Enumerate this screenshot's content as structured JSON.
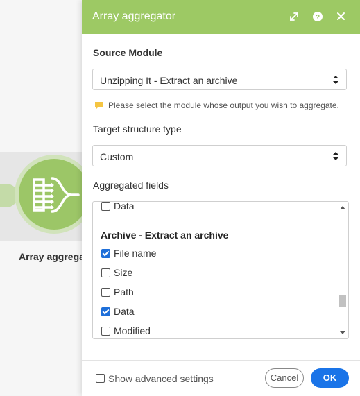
{
  "canvas": {
    "module_name": "Array aggregat"
  },
  "dialog": {
    "title": "Array aggregator",
    "header_color": "#9dc964",
    "source_module": {
      "label": "Source Module",
      "value": "Unzipping It - Extract an archive"
    },
    "hint": "Please select the module whose output you wish to aggregate.",
    "target_structure": {
      "label": "Target structure type",
      "value": "Custom"
    },
    "aggregated_fields": {
      "label": "Aggregated fields",
      "top_item": {
        "label": "Data",
        "checked": false
      },
      "group_title": "Archive - Extract an archive",
      "items": [
        {
          "label": "File name",
          "checked": true
        },
        {
          "label": "Size",
          "checked": false
        },
        {
          "label": "Path",
          "checked": false
        },
        {
          "label": "Data",
          "checked": true
        },
        {
          "label": "Modified",
          "checked": false
        }
      ]
    },
    "footer": {
      "advanced_label": "Show advanced settings",
      "cancel_label": "Cancel",
      "ok_label": "OK",
      "ok_color": "#1a74e8"
    }
  }
}
